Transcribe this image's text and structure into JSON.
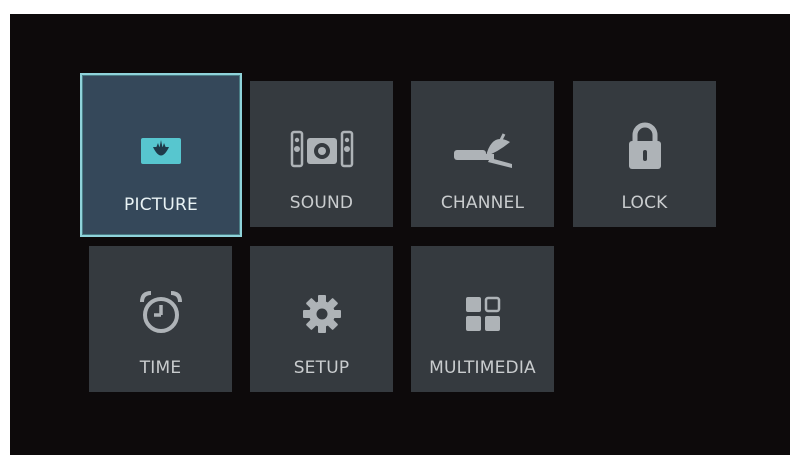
{
  "menu": {
    "selected": "PICTURE",
    "accent_color": "#8fd3da",
    "items": [
      {
        "label": "PICTURE",
        "icon": "picture-icon"
      },
      {
        "label": "SOUND",
        "icon": "speakers-icon"
      },
      {
        "label": "CHANNEL",
        "icon": "satellite-dish-icon"
      },
      {
        "label": "LOCK",
        "icon": "padlock-icon"
      },
      {
        "label": "TIME",
        "icon": "alarm-clock-icon"
      },
      {
        "label": "SETUP",
        "icon": "gear-icon"
      },
      {
        "label": "MULTIMEDIA",
        "icon": "multimedia-grid-icon"
      }
    ]
  }
}
